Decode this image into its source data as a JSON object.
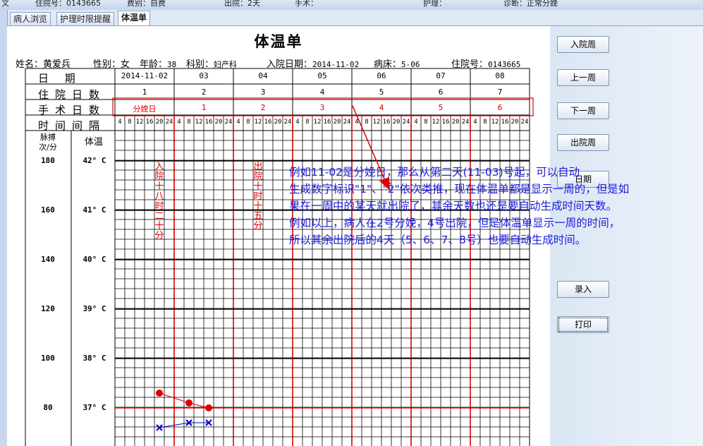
{
  "topbar": {
    "texts": [
      "文",
      "住院号：0143665",
      "费别：自费",
      "出院：2天",
      "手术：",
      "护理：",
      "诊断：正常分娩"
    ]
  },
  "tabs": [
    {
      "label": "病人浏览",
      "active": false
    },
    {
      "label": "护理时限提醒",
      "active": false
    },
    {
      "label": "体温单",
      "active": true
    }
  ],
  "sheet": {
    "title": "体温单",
    "patient": {
      "name_label": "姓名：黄爱兵",
      "gender_label": "性别：女",
      "age_label": "年龄：",
      "age_value": "38",
      "dept_label": "科别：",
      "dept_value": "妇产科",
      "admit_label": "入院日期：",
      "admit_value": "2014-11-02",
      "bed_label": "病床：",
      "bed_value": "5-06",
      "inpatient_no_label": "住院号：",
      "inpatient_no_value": "0143665"
    },
    "row_labels": {
      "date": "日 期",
      "hospital_day": "住院日数",
      "surgery_day": "手术日数",
      "time_interval": "时间间隔"
    },
    "dates": [
      "2014-11-02",
      "03",
      "04",
      "05",
      "06",
      "07",
      "08"
    ],
    "hospital_days": [
      "1",
      "2",
      "3",
      "4",
      "5",
      "6",
      "7"
    ],
    "surgery_days": [
      "分娩日",
      "1",
      "2",
      "3",
      "4",
      "5",
      "6"
    ],
    "time_slots": [
      "4",
      "8",
      "12",
      "16",
      "20",
      "24"
    ],
    "pulse_header": "脉搏\n次/分",
    "temp_header": "体温",
    "pulse_scale": [
      "180",
      "160",
      "140",
      "120",
      "100",
      "80"
    ],
    "temp_scale": [
      "42° C",
      "41° C",
      "40° C",
      "39° C",
      "38° C",
      "37° C"
    ],
    "events": [
      {
        "text": "入院十八时二十分",
        "day": 0,
        "slot": 4
      },
      {
        "text": "出院十时十五分",
        "day": 2,
        "slot": 2
      }
    ],
    "pulse_points": [
      {
        "day": 0,
        "slot": 4,
        "value": 37.3
      },
      {
        "day": 1,
        "slot": 1,
        "value": 37.1
      },
      {
        "day": 1,
        "slot": 3,
        "value": 37.0
      }
    ],
    "temp_points": [
      {
        "day": 0,
        "slot": 4,
        "value": 36.6
      },
      {
        "day": 1,
        "slot": 1,
        "value": 36.7
      },
      {
        "day": 1,
        "slot": 3,
        "value": 36.7
      }
    ]
  },
  "annotation": {
    "lines": [
      "例如11-02是分娩日，那么从第二天(11-03)号起，可以自动",
      "生成数字标识\"1\"、\"2\"依次类推，现在体温单都是显示一周的，但是如",
      "果在一周中的某天就出院了，其余天数也还是要自动生成时间天数。",
      "例如以上，病人在2号分娩，4号出院，但是体温单显示一周的时间，",
      "所以其余出院后的4天（5、6、7、8号）也要自动生成时间。"
    ]
  },
  "buttons": [
    "入院周",
    "上一周",
    "下一周",
    "出院周",
    "日期",
    "录入",
    "打印"
  ],
  "colors": {
    "grid": "#000000",
    "red": "#dd0000",
    "pulse_line": "#dd0000",
    "temp_line": "#0000cc",
    "annotation_text": "#1c1cd8"
  }
}
